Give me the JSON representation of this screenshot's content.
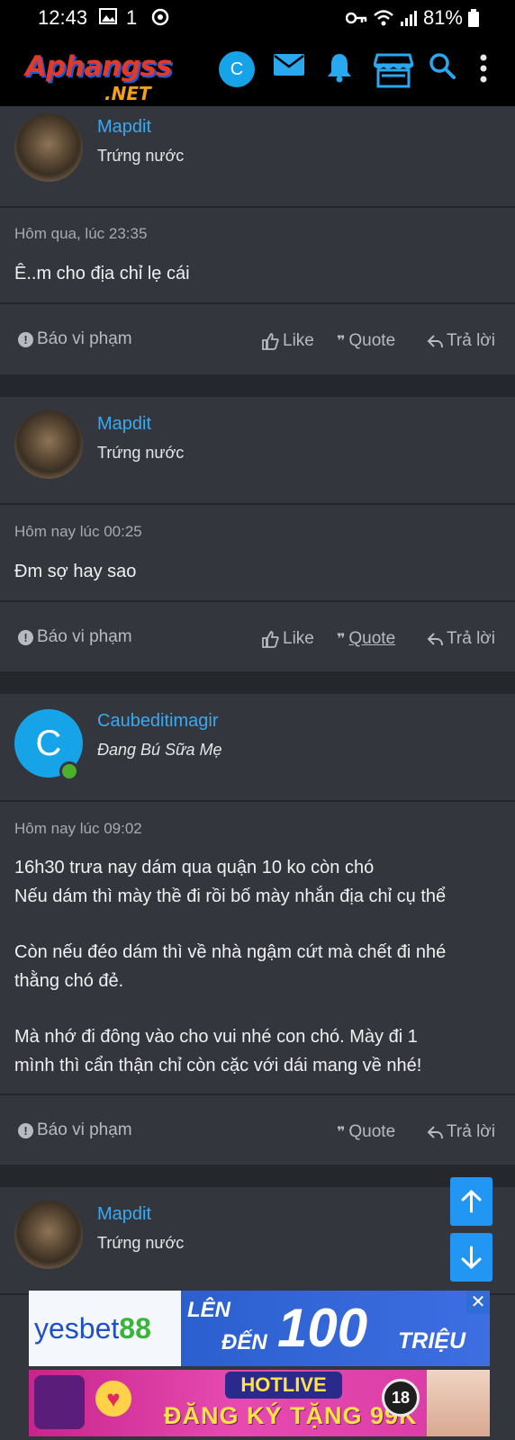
{
  "status_bar": {
    "time": "12:43",
    "mode_indicator": "1",
    "battery": "81%"
  },
  "header": {
    "logo_main": "Aphangss",
    "logo_sub": ".NET",
    "avatar_letter": "C",
    "icons": [
      "envelope-icon",
      "bell-icon",
      "store-icon",
      "search-icon",
      "more-vertical-icon"
    ]
  },
  "posts": [
    {
      "author": "Mapdit",
      "user_title": "Trứng nước",
      "date": "Hôm qua, lúc 23:35",
      "lines": [
        "Ê..m cho địa chỉ lẹ cái"
      ],
      "report": "Báo vi phạm",
      "like": "Like",
      "quote": "Quote",
      "reply": "Trả lời"
    },
    {
      "author": "Mapdit",
      "user_title": "Trứng nước",
      "date": "Hôm nay lúc 00:25",
      "lines": [
        "Đm sợ hay sao"
      ],
      "report": "Báo vi phạm",
      "like": "Like",
      "quote": "Quote",
      "reply": "Trả lời"
    },
    {
      "author": "Caubeditimagir",
      "avatar_letter": "C",
      "user_title": "Đang Bú Sữa Mẹ",
      "date": "Hôm nay lúc 09:02",
      "lines": [
        "16h30 trưa nay dám qua quận 10 ko còn chó",
        "Nếu dám thì mày thề đi rồi bố mày nhắn địa chỉ cụ thể",
        "Còn nếu đéo dám thì về nhà ngậm cứt mà chết đi nhé",
        "thằng chó đẻ.",
        "Mà nhớ đi đông vào cho vui nhé con chó. Mày đi 1",
        "mình thì cẩn thận chỉ còn cặc với dái mang về nhé!"
      ],
      "report": "Báo vi phạm",
      "quote": "Quote",
      "reply": "Trả lời"
    },
    {
      "author": "Mapdit",
      "user_title": "Trứng nước"
    }
  ],
  "ads": {
    "banner1": {
      "brand": "yesbet",
      "brand_num": "88",
      "line1": "LÊN",
      "line2": "ĐẾN",
      "amount": "100",
      "unit": "TRIỆU"
    },
    "banner2": {
      "title": "HOTLIVE",
      "cta": "ĐĂNG KÝ TẶNG 99K",
      "age": "18"
    }
  },
  "colors": {
    "accent": "#3aa9f0",
    "background": "#24272c",
    "card": "#33363d",
    "fab": "#2296f3"
  }
}
